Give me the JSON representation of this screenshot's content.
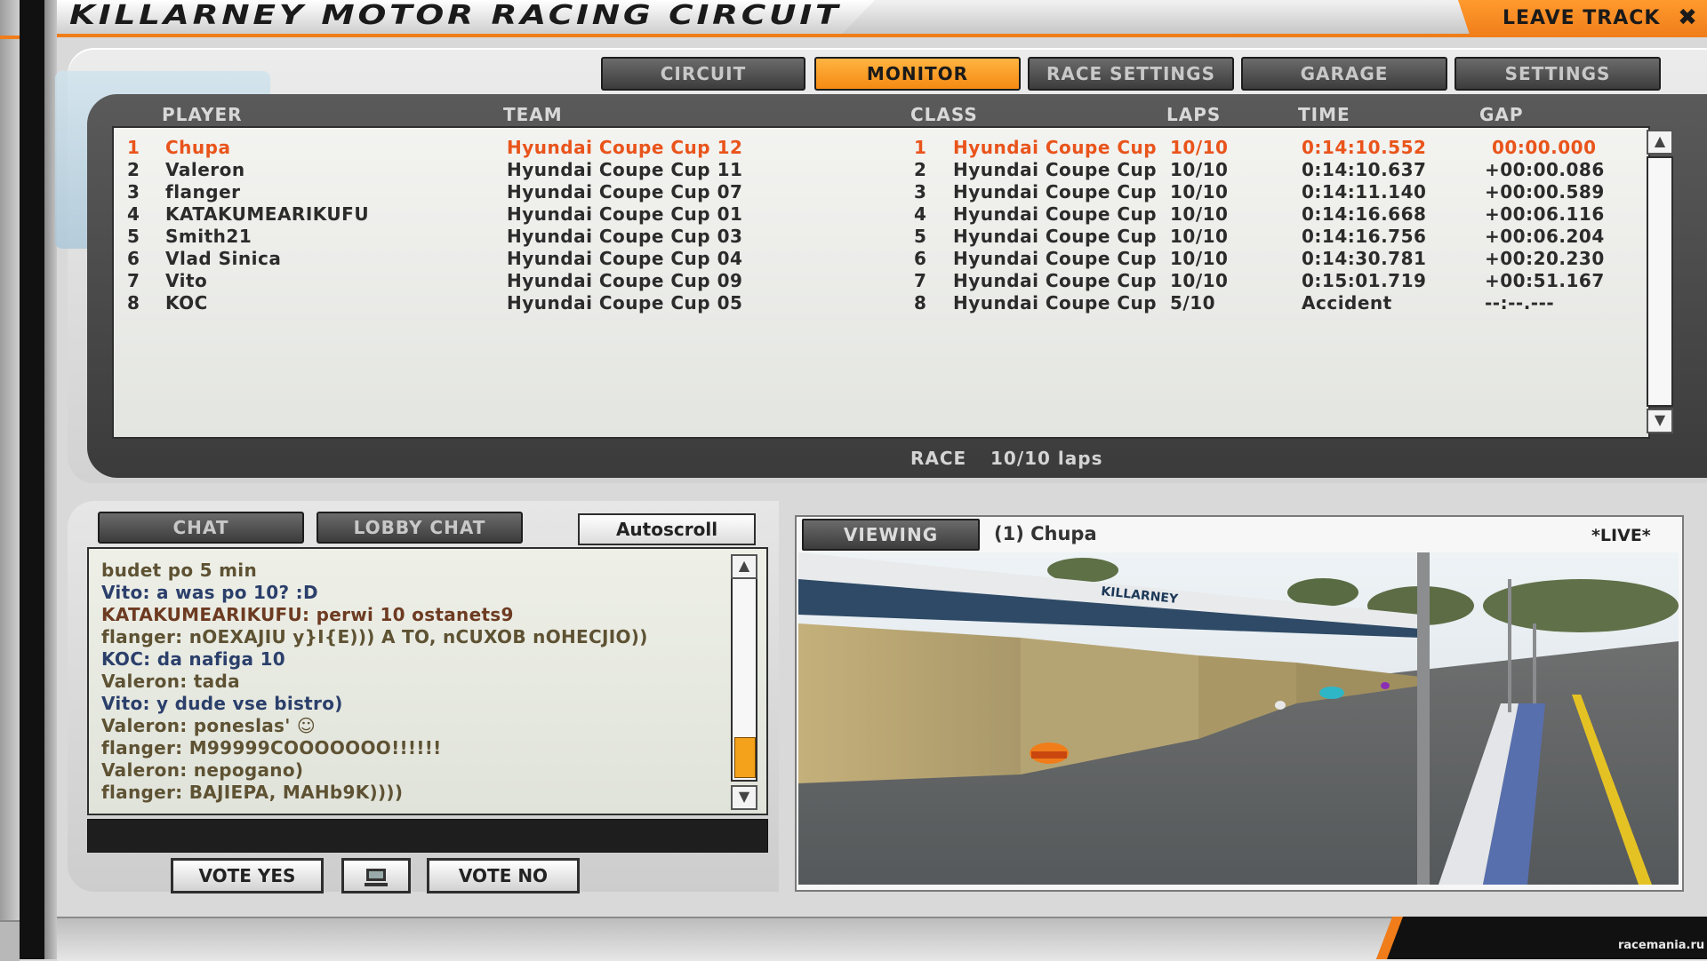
{
  "header": {
    "title": "KILLARNEY MOTOR RACING CIRCUIT",
    "leave_track": "LEAVE TRACK",
    "close_glyph": "✖"
  },
  "tabs": [
    {
      "label": "CIRCUIT",
      "active": false
    },
    {
      "label": "MONITOR",
      "active": true
    },
    {
      "label": "RACE SETTINGS",
      "active": false
    },
    {
      "label": "GARAGE",
      "active": false
    },
    {
      "label": "SETTINGS",
      "active": false
    }
  ],
  "results": {
    "columns": {
      "player": "PLAYER",
      "team": "TEAM",
      "class": "CLASS",
      "laps": "LAPS",
      "time": "TIME",
      "gap": "GAP"
    },
    "rows": [
      {
        "pos": "1",
        "player": "Chupa",
        "team": "Hyundai Coupe Cup 12",
        "class_pos": "1",
        "class": "Hyundai Coupe Cup",
        "laps": "10/10",
        "time": "0:14:10.552",
        "gap": "00:00.000"
      },
      {
        "pos": "2",
        "player": "Valeron",
        "team": "Hyundai Coupe Cup 11",
        "class_pos": "2",
        "class": "Hyundai Coupe Cup",
        "laps": "10/10",
        "time": "0:14:10.637",
        "gap": "+00:00.086"
      },
      {
        "pos": "3",
        "player": "flanger",
        "team": "Hyundai Coupe Cup 07",
        "class_pos": "3",
        "class": "Hyundai Coupe Cup",
        "laps": "10/10",
        "time": "0:14:11.140",
        "gap": "+00:00.589"
      },
      {
        "pos": "4",
        "player": "KATAKUMEARIKUFU",
        "team": "Hyundai Coupe Cup 01",
        "class_pos": "4",
        "class": "Hyundai Coupe Cup",
        "laps": "10/10",
        "time": "0:14:16.668",
        "gap": "+00:06.116"
      },
      {
        "pos": "5",
        "player": "Smith21",
        "team": "Hyundai Coupe Cup 03",
        "class_pos": "5",
        "class": "Hyundai Coupe Cup",
        "laps": "10/10",
        "time": "0:14:16.756",
        "gap": "+00:06.204"
      },
      {
        "pos": "6",
        "player": "Vlad Sinica",
        "team": "Hyundai Coupe Cup 04",
        "class_pos": "6",
        "class": "Hyundai Coupe Cup",
        "laps": "10/10",
        "time": "0:14:30.781",
        "gap": "+00:20.230"
      },
      {
        "pos": "7",
        "player": "Vito",
        "team": "Hyundai Coupe Cup 09",
        "class_pos": "7",
        "class": "Hyundai Coupe Cup",
        "laps": "10/10",
        "time": "0:15:01.719",
        "gap": "+00:51.167"
      },
      {
        "pos": "8",
        "player": "KOC",
        "team": "Hyundai Coupe Cup 05",
        "class_pos": "8",
        "class": "Hyundai Coupe Cup",
        "laps": "5/10",
        "time": "Accident",
        "gap": "--:--.---"
      }
    ],
    "race_label": "RACE",
    "race_laps": "10/10 laps"
  },
  "chat": {
    "tab_chat": "CHAT",
    "tab_lobby": "LOBBY CHAT",
    "autoscroll": "Autoscroll",
    "scroll_thumb_fraction": 0.2,
    "messages": [
      {
        "text": "budet po 5 min",
        "color": "olive"
      },
      {
        "text": "Vito: a was po 10? :D",
        "color": "blue"
      },
      {
        "text": "KATAKUMEARIKUFU: perwi 10 ostanets9",
        "color": "maroon"
      },
      {
        "text": "flanger: nOEXAJIU y}I{E))) A TO, nCUXOB nOHECJIO))",
        "color": "olive"
      },
      {
        "text": "KOC: da nafiga 10",
        "color": "blue"
      },
      {
        "text": "Valeron: tada",
        "color": "olive"
      },
      {
        "text": "Vito: y dude vse bistro)",
        "color": "blue"
      },
      {
        "text": "Valeron: poneslas' ☺",
        "color": "olive"
      },
      {
        "text": "flanger: M99999COOOOOOO!!!!!!",
        "color": "olive"
      },
      {
        "text": "Valeron: nepogano)",
        "color": "olive"
      },
      {
        "text": "flanger: BAJIEPA, MAHb9K))))",
        "color": "olive"
      }
    ],
    "vote_yes": "VOTE YES",
    "vote_no": "VOTE NO",
    "monitor_icon": "monitor-icon"
  },
  "viewer": {
    "viewing_label": "VIEWING",
    "viewing_player": "(1) Chupa",
    "live": "*LIVE*",
    "banner": "KILLARNEY"
  },
  "watermark": "racemania.ru",
  "colors": {
    "accent": "#f07d1a",
    "leader": "#e9541b",
    "panel_dark": "#3b3b3b"
  }
}
